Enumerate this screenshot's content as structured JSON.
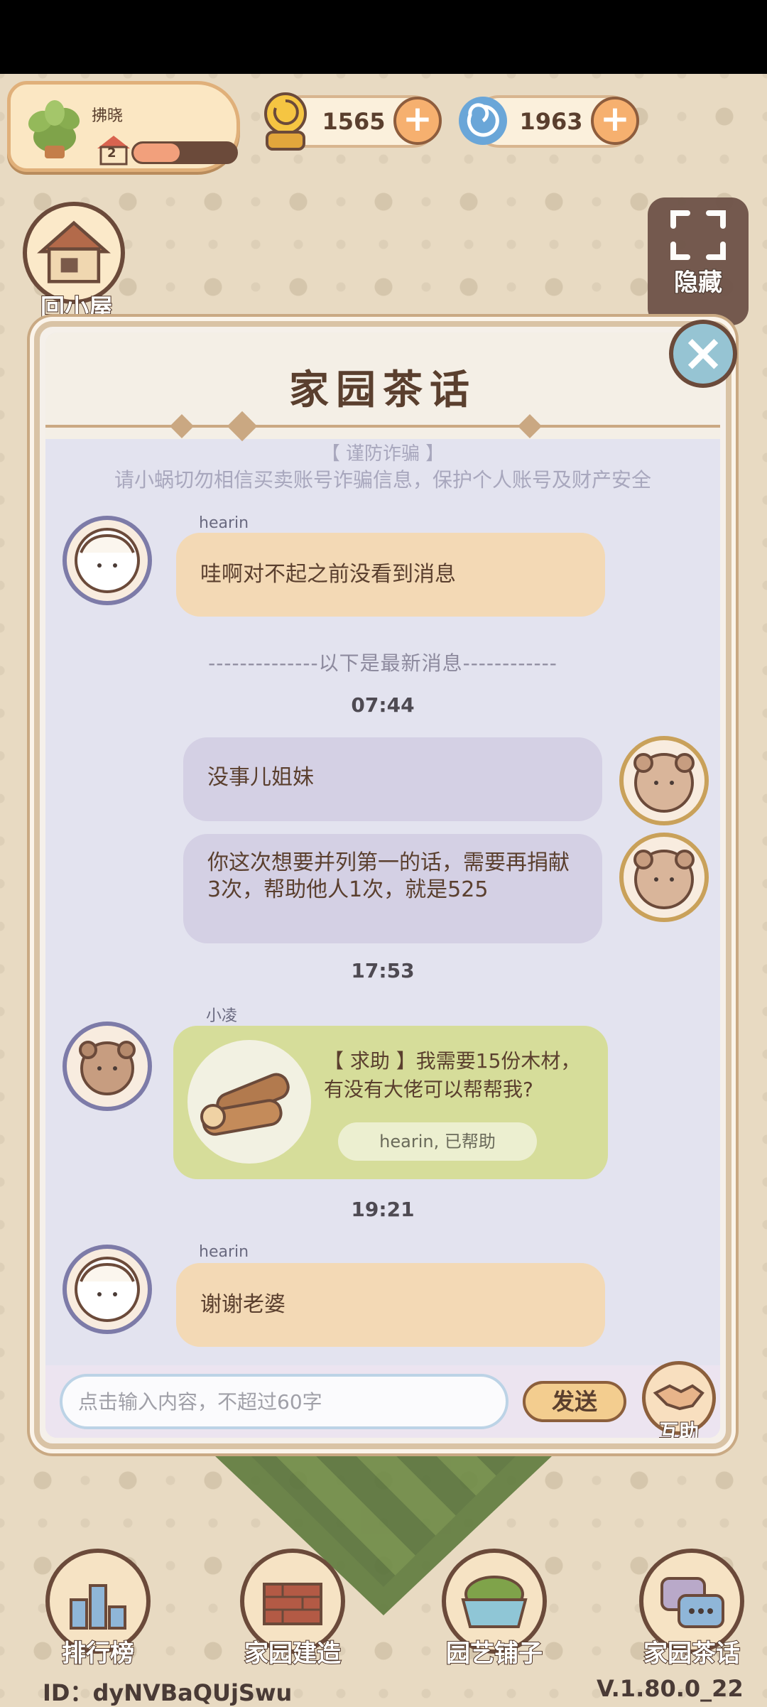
{
  "player": {
    "name": "拂晓",
    "level": "2",
    "level_progress": 0.45
  },
  "currencies": [
    {
      "icon": "snail-coin-icon",
      "value": "1565"
    },
    {
      "icon": "blue-swirl-icon",
      "value": "1963"
    }
  ],
  "side_buttons": {
    "home": "回小屋",
    "hide": "隐藏"
  },
  "dialog": {
    "title": "家园茶话",
    "notice_title": "【 谨防诈骗 】",
    "notice_text": "请小蜗切勿相信买卖账号诈骗信息，保护个人账号及财产安全",
    "messages": [
      {
        "sender": "hearin",
        "text": "哇啊对不起之前没看到消息"
      },
      {
        "separator": "--------------以下是最新消息------------"
      },
      {
        "time": "07:44"
      },
      {
        "text": "没事儿姐妹"
      },
      {
        "text": "你这次想要并列第一的话，需要再捐献3次，帮助他人1次，就是525"
      },
      {
        "time": "17:53"
      },
      {
        "sender": "小凌",
        "help_request": "【 求助 】我需要15份木材，有没有大佬可以帮帮我?",
        "helped_status": "hearin, 已帮助"
      },
      {
        "time": "19:21"
      },
      {
        "sender": "hearin",
        "text": "谢谢老婆"
      }
    ],
    "input_placeholder": "点击输入内容，不超过60字",
    "send_label": "发送",
    "mutual_help_label": "互助"
  },
  "bottom_nav": [
    "排行榜",
    "家园建造",
    "园艺铺子",
    "家园茶话"
  ],
  "footer": {
    "id": "ID：dyNVBaQUjSwu",
    "version": "V.1.80.0_22"
  },
  "colors": {
    "accent_orange": "#f6b06f",
    "bubble_mine": "#d4d0e4",
    "bubble_theirs": "#f3d9b5",
    "help_card": "#d6dd9a"
  }
}
